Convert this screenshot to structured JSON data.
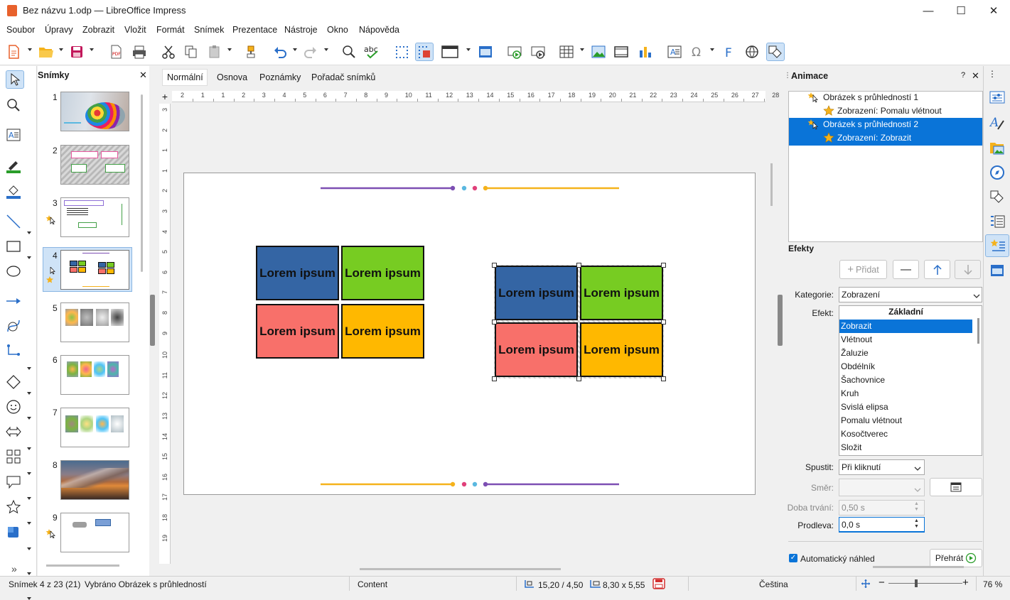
{
  "window": {
    "title": "Bez názvu 1.odp — LibreOffice Impress",
    "min": "—",
    "max": "☐",
    "close": "✕"
  },
  "menu": [
    "Soubor",
    "Úpravy",
    "Zobrazit",
    "Vložit",
    "Formát",
    "Snímek",
    "Prezentace",
    "Nástroje",
    "Okno",
    "Nápověda"
  ],
  "slides_panel": {
    "title": "Snímky",
    "close": "✕",
    "numbers": [
      "1",
      "2",
      "3",
      "4",
      "5",
      "6",
      "7",
      "8",
      "9"
    ],
    "selected": "4",
    "expand": "»"
  },
  "view_tabs": [
    "Normální",
    "Osnova",
    "Poznámky",
    "Pořadač snímků"
  ],
  "ruler": {
    "h": [
      "2",
      "1",
      "1",
      "2",
      "3",
      "4",
      "5",
      "6",
      "7",
      "8",
      "9",
      "10",
      "11",
      "12",
      "13",
      "14",
      "15",
      "16",
      "17",
      "18",
      "19",
      "20",
      "21",
      "22",
      "23",
      "24",
      "25",
      "26",
      "27",
      "28"
    ],
    "v": [
      "3",
      "2",
      "1",
      "1",
      "2",
      "3",
      "4",
      "5",
      "6",
      "7",
      "8",
      "9",
      "10",
      "11",
      "12",
      "13",
      "14",
      "15",
      "16",
      "17",
      "18",
      "19"
    ]
  },
  "slide": {
    "left_boxes": [
      "Lorem ipsum",
      "Lorem ipsum",
      "Lorem ipsum",
      "Lorem ipsum"
    ],
    "right_boxes": [
      "Lorem ipsum",
      "Lorem ipsum",
      "Lorem ipsum",
      "Lorem ipsum"
    ]
  },
  "colors": {
    "blue": "#3465a4",
    "green": "#77cc22",
    "red": "#f8706a",
    "orange": "#ffb800",
    "purple": "#7d4fb3",
    "cyan": "#5ab8e0",
    "pink": "#e0407a",
    "gold": "#f5b21b",
    "selection": "#0a74d8"
  },
  "animation": {
    "title": "Animace",
    "help": "?",
    "close": "✕",
    "tree": [
      {
        "label": "Obrázek s průhledností 1",
        "type": "object"
      },
      {
        "label": "Zobrazení: Pomalu vlétnout",
        "type": "effect"
      },
      {
        "label": "Obrázek s průhledností 2",
        "type": "object"
      },
      {
        "label": "Zobrazení: Zobrazit",
        "type": "effect"
      }
    ],
    "effects_label": "Efekty",
    "add_label": "Přidat",
    "category_label": "Kategorie:",
    "category_value": "Zobrazení",
    "effect_label": "Efekt:",
    "effect_group": "Základní",
    "effects": [
      "Zobrazit",
      "Vlétnout",
      "Žaluzie",
      "Obdélník",
      "Šachovnice",
      "Kruh",
      "Svislá elipsa",
      "Pomalu vlétnout",
      "Kosočtverec",
      "Složit"
    ],
    "start_label": "Spustit:",
    "start_value": "Při kliknutí",
    "direction_label": "Směr:",
    "duration_label": "Doba trvání:",
    "duration_value": "0,50 s",
    "delay_label": "Prodleva:",
    "delay_value": "0,0 s",
    "autopreview_label": "Automatický náhled",
    "play_label": "Přehrát"
  },
  "status": {
    "slide": "Snímek 4 z 23 (21)",
    "selection": "Vybráno Obrázek s průhledností",
    "layout": "Content",
    "position": "15,20 / 4,50",
    "size": "8,30 x 5,55",
    "language": "Čeština",
    "zoom": "76 %"
  }
}
